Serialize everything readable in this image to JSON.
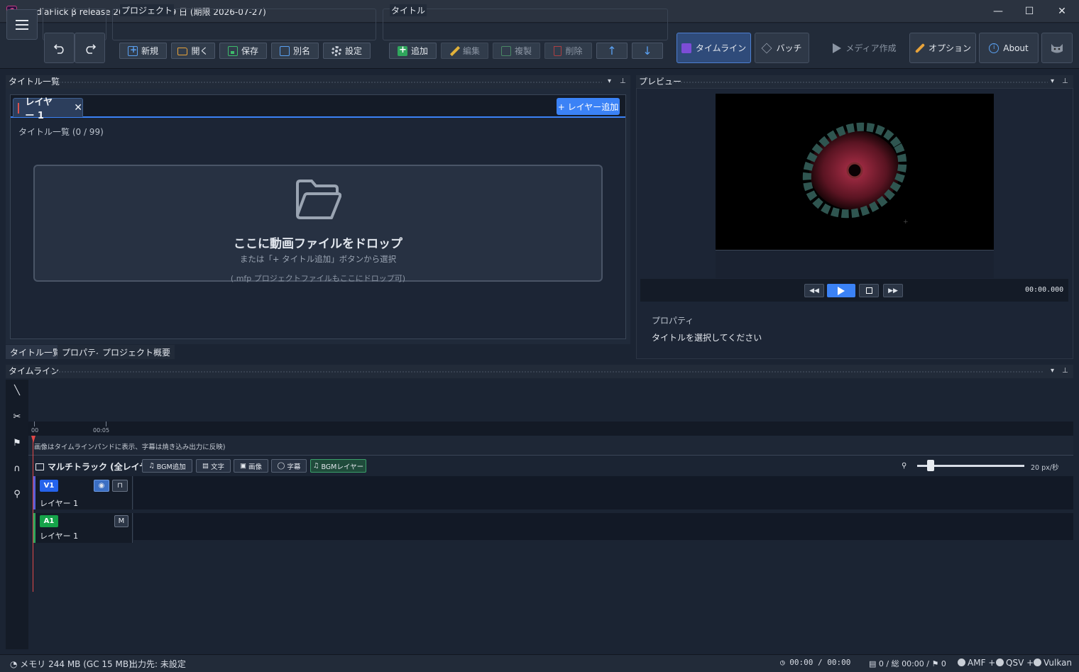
{
  "window": {
    "title": "mediaFlick β release 260528 - 残 59 日 (期限 2026-07-27)",
    "minimize": "—",
    "maximize": "☐",
    "close": "✕"
  },
  "toolbar": {
    "menu_icon": "hamburger-icon",
    "undo_icon": "undo-icon",
    "redo_icon": "redo-icon",
    "project_label": "プロジェクト",
    "project_buttons": [
      "新規",
      "開く",
      "保存",
      "別名",
      "設定"
    ],
    "title_label": "タイトル",
    "title_buttons": [
      "追加",
      "編集",
      "複製",
      "削除"
    ],
    "up_arrow": "↑",
    "down_arrow": "↓",
    "timeline_btn": "タイムライン",
    "batch_btn": "バッチ",
    "media_btn": "メディア作成",
    "options_btn": "オプション",
    "about_btn": "About"
  },
  "title_panel": {
    "header": "タイトル一覧",
    "layer_tab": "レイヤー 1",
    "tab_close": "✕",
    "add_layer": "+ レイヤー追加",
    "count": "タイトル一覧 (0 / 99)",
    "drop_title": "ここに動画ファイルをドロップ",
    "drop_sub": "または「+ タイトル追加」ボタンから選択",
    "drop_note": "(.mfp プロジェクトファイルもここにドロップ可)",
    "bottom_tabs": [
      "タイトル一覧",
      "プロパティ",
      "プロジェクト概要"
    ]
  },
  "preview": {
    "header": "プレビュー",
    "time": "00:00.000",
    "prop_label": "プロパティ",
    "prop_msg": "タイトルを選択してください"
  },
  "timeline": {
    "header": "タイムライン",
    "ticks": [
      "00",
      "00:05"
    ],
    "note": "画像はタイムラインパンドに表示、字幕は焼き込み出力に反映)",
    "multitrack": "マルチトラック (全レイヤー)",
    "chips": [
      "BGM追加",
      "文字",
      "画像",
      "字幕",
      "BGMレイヤー"
    ],
    "zoom_value": "20 px/秒",
    "zoom_level": 0.1,
    "tracks": [
      {
        "badge": "V1",
        "name": "レイヤー 1",
        "color": "#2563eb"
      },
      {
        "badge": "A1",
        "name": "レイヤー 1",
        "color": "#16a34a",
        "mute": "M"
      }
    ]
  },
  "status": {
    "memory": "メモリ 244 MB (GC 15 MB)",
    "output": "出力先: 未設定",
    "time": "00:00 / 00:00",
    "summary": "0 / 総 00:00 / ⚑ 0",
    "gpu": [
      "AMF +",
      "QSV +",
      "Vulkan"
    ]
  }
}
